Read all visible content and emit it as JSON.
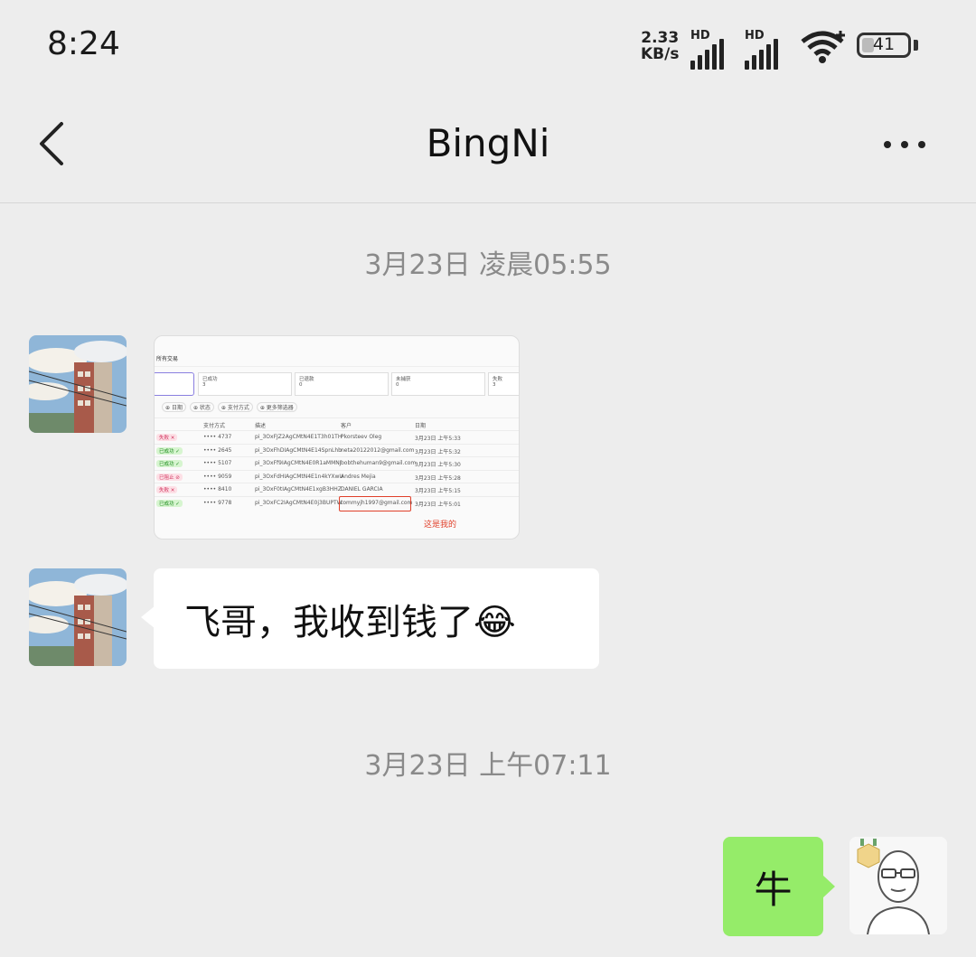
{
  "status_bar": {
    "time": "8:24",
    "net_speed_value": "2.33",
    "net_speed_unit": "KB/s",
    "hd1": "HD",
    "hd2": "HD",
    "battery": "41"
  },
  "header": {
    "title": "BingNi"
  },
  "messages": {
    "ts1": "3月23日 凌晨05:55",
    "ts2": "3月23日 上午07:11",
    "text1": "飞哥，我收到钱了😂",
    "text2": "牛"
  },
  "screenshot": {
    "page_label": "所有交易",
    "cards": [
      {
        "label": "已成功",
        "value": "3"
      },
      {
        "label": "已退款",
        "value": "0"
      },
      {
        "label": "未捕获",
        "value": "0"
      },
      {
        "label": "失败",
        "value": "3"
      }
    ],
    "filters": [
      "日期",
      "状态",
      "支付方式",
      "更多筛选器"
    ],
    "columns": [
      "支付方式",
      "描述",
      "客户",
      "日期"
    ],
    "rows": [
      {
        "status": "失败 ✕",
        "card": "•••• 4737",
        "desc": "pi_3OxFJZ2AgCMtN4E1T3h01TH",
        "customer": "Pkorsteev Oleg",
        "date": "3月23日 上午5:33",
        "status_color": "#d0345f"
      },
      {
        "status": "已成功 ✓",
        "card": "•••• 2645",
        "desc": "pi_3OxFhDIAgCMtN4E14SpnLhb",
        "customer": "neta20122012@gmail.com",
        "date": "3月23日 上午5:32",
        "status_color": "#1a8a1a"
      },
      {
        "status": "已成功 ✓",
        "card": "•••• 5107",
        "desc": "pi_3OxFf9IAgCMtN4E0R1aMMNJ",
        "customer": "bobthehuman9@gmail.com",
        "date": "3月23日 上午5:30",
        "status_color": "#1a8a1a"
      },
      {
        "status": "已阻止 ⊘",
        "card": "•••• 9059",
        "desc": "pi_3OxFdHIAgCMtN4E1n4kYXwU",
        "customer": "Andres Mejia",
        "date": "3月23日 上午5:28",
        "status_color": "#d0345f"
      },
      {
        "status": "失败 ✕",
        "card": "•••• 8410",
        "desc": "pi_3OxF0tIAgCMtN4E1xgB3HHZ",
        "customer": "DANIEL GARCIA",
        "date": "3月23日 上午5:15",
        "status_color": "#d0345f"
      },
      {
        "status": "已成功 ✓",
        "card": "•••• 9778",
        "desc": "pi_3OxFC2IAgCMtN4E0j3BUPTW",
        "customer": "tommyjh1997@gmail.com",
        "date": "3月23日 上午5:01",
        "status_color": "#1a8a1a"
      }
    ],
    "annotation": "这是我的"
  },
  "colors": {
    "background": "#ededed",
    "my_bubble": "#95ec69",
    "annotation": "#e0402a"
  }
}
